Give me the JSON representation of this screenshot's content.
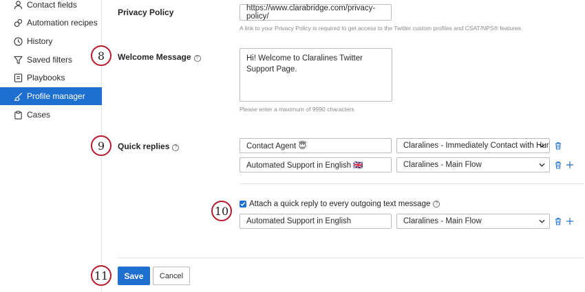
{
  "sidebar": {
    "items": [
      {
        "label": "Contact fields",
        "icon": "person-icon",
        "active": false
      },
      {
        "label": "Automation recipes",
        "icon": "recipe-icon",
        "active": false
      },
      {
        "label": "History",
        "icon": "clock-icon",
        "active": false
      },
      {
        "label": "Saved filters",
        "icon": "filter-icon",
        "active": false
      },
      {
        "label": "Playbooks",
        "icon": "playbook-icon",
        "active": false
      },
      {
        "label": "Profile manager",
        "icon": "brush-icon",
        "active": true
      },
      {
        "label": "Cases",
        "icon": "clipboard-icon",
        "active": false
      }
    ]
  },
  "form": {
    "privacy_policy": {
      "label": "Privacy Policy",
      "value": "https://www.clarabridge.com/privacy-policy/",
      "help": "A link to your Privacy Policy is required to get access to the Twitter custom profiles and CSAT/NPS® features"
    },
    "welcome_message": {
      "label": "Welcome Message",
      "value": "Hi! Welcome to Claralines Twitter Support Page.",
      "help": "Please enter a maximum of 9990 characters"
    },
    "quick_replies": {
      "label": "Quick replies",
      "rows": [
        {
          "text": "Contact Agent 😇",
          "flow": "Claralines - Immediately Contact with Hur"
        },
        {
          "text": "Automated Support in English 🇬🇧",
          "flow": "Claralines - Main Flow"
        }
      ]
    },
    "attach": {
      "label": "Attach a quick reply to every outgoing text message",
      "checked": true,
      "text": "Automated Support in English",
      "flow": "Claralines - Main Flow"
    },
    "save_label": "Save",
    "cancel_label": "Cancel"
  },
  "callouts": [
    "8",
    "9",
    "10",
    "11"
  ],
  "colors": {
    "accent": "#1f6fd1",
    "callout_ring": "#b5172b"
  }
}
